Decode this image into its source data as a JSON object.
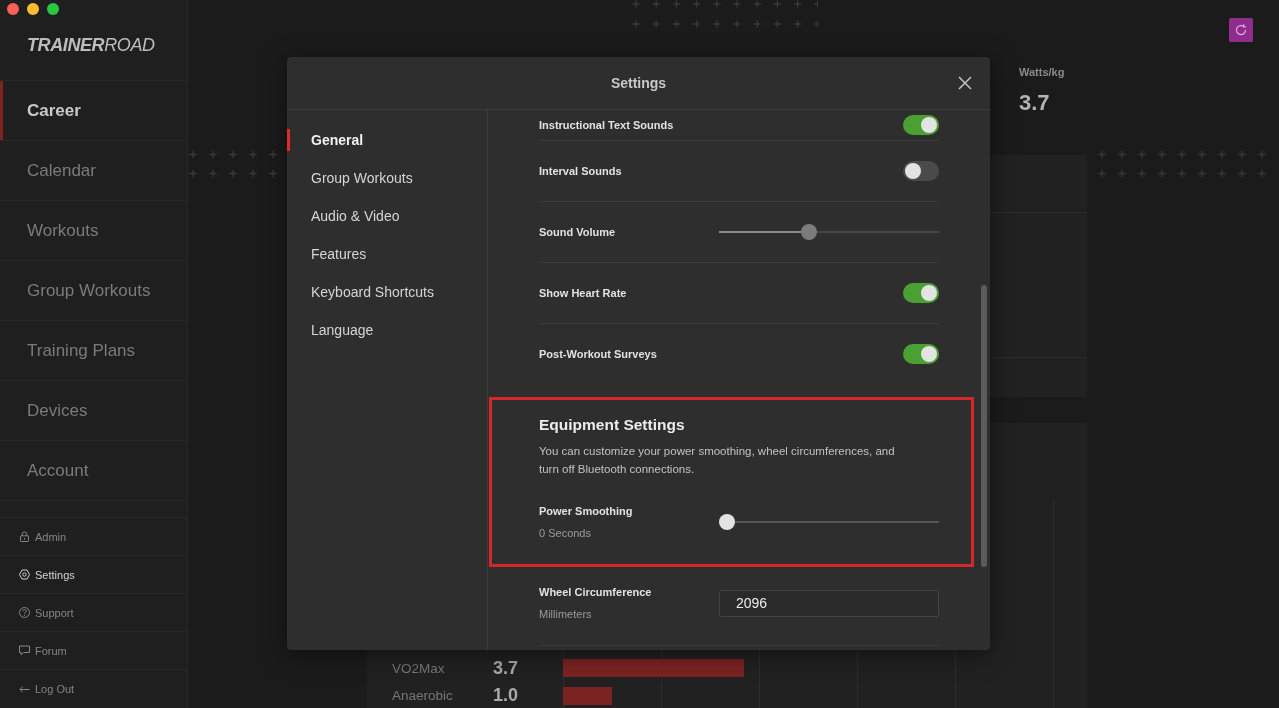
{
  "window": {
    "controls": [
      {
        "kind": "close"
      },
      {
        "kind": "minimize"
      },
      {
        "kind": "zoom"
      }
    ]
  },
  "sidebar": {
    "logo": "**TRAINER**ROAD",
    "items": [
      {
        "label": "Career",
        "selected": true
      },
      {
        "label": "Calendar",
        "selected": false
      },
      {
        "label": "Workouts",
        "selected": false
      },
      {
        "label": "Group Workouts",
        "selected": false
      },
      {
        "label": "Training Plans",
        "selected": false
      },
      {
        "label": "Devices",
        "selected": false
      },
      {
        "label": "Account",
        "selected": false
      }
    ],
    "footer_items": [
      {
        "kind": "admin",
        "label": "Admin",
        "selected": false
      },
      {
        "kind": "settings",
        "label": "Settings",
        "selected": true
      },
      {
        "kind": "support",
        "label": "Support",
        "selected": false
      },
      {
        "kind": "forum",
        "label": "Forum",
        "selected": false
      },
      {
        "kind": "logout",
        "label": "Log Out",
        "selected": false
      }
    ]
  },
  "background": {
    "stat": {
      "label": "Watts/kg",
      "value": "3.7"
    },
    "progression_levels": [
      {
        "name": "VO2Max",
        "value": "3.7",
        "level": 0.37
      },
      {
        "name": "Anaerobic",
        "value": "1.0",
        "level": 0.1
      }
    ]
  },
  "modal": {
    "title": "Settings",
    "nav": [
      {
        "label": "General",
        "selected": true
      },
      {
        "label": "Group Workouts",
        "selected": false
      },
      {
        "label": "Audio & Video",
        "selected": false
      },
      {
        "label": "Features",
        "selected": false
      },
      {
        "label": "Keyboard Shortcuts",
        "selected": false
      },
      {
        "label": "Language",
        "selected": false
      }
    ],
    "rows": [
      {
        "kind": "toggle",
        "label": "Instructional Text Sounds",
        "on": true
      },
      {
        "kind": "toggle",
        "label": "Interval Sounds",
        "on": false
      },
      {
        "kind": "slider",
        "label": "Sound Volume",
        "level": 0.4
      },
      {
        "kind": "toggle",
        "label": "Show Heart Rate",
        "on": true
      },
      {
        "kind": "toggle",
        "label": "Post-Workout Surveys",
        "on": true
      }
    ],
    "equipment": {
      "title": "Equipment Settings",
      "description": "You can customize your power smoothing, wheel circumferences, and turn off Bluetooth connections.",
      "highlighted": true,
      "power_smoothing": {
        "label": "Power Smoothing",
        "reading": "0 Seconds",
        "level": 0
      },
      "wheel_circumference": {
        "label": "Wheel Circumference",
        "unit": "Millimeters",
        "value": "2096"
      }
    }
  }
}
